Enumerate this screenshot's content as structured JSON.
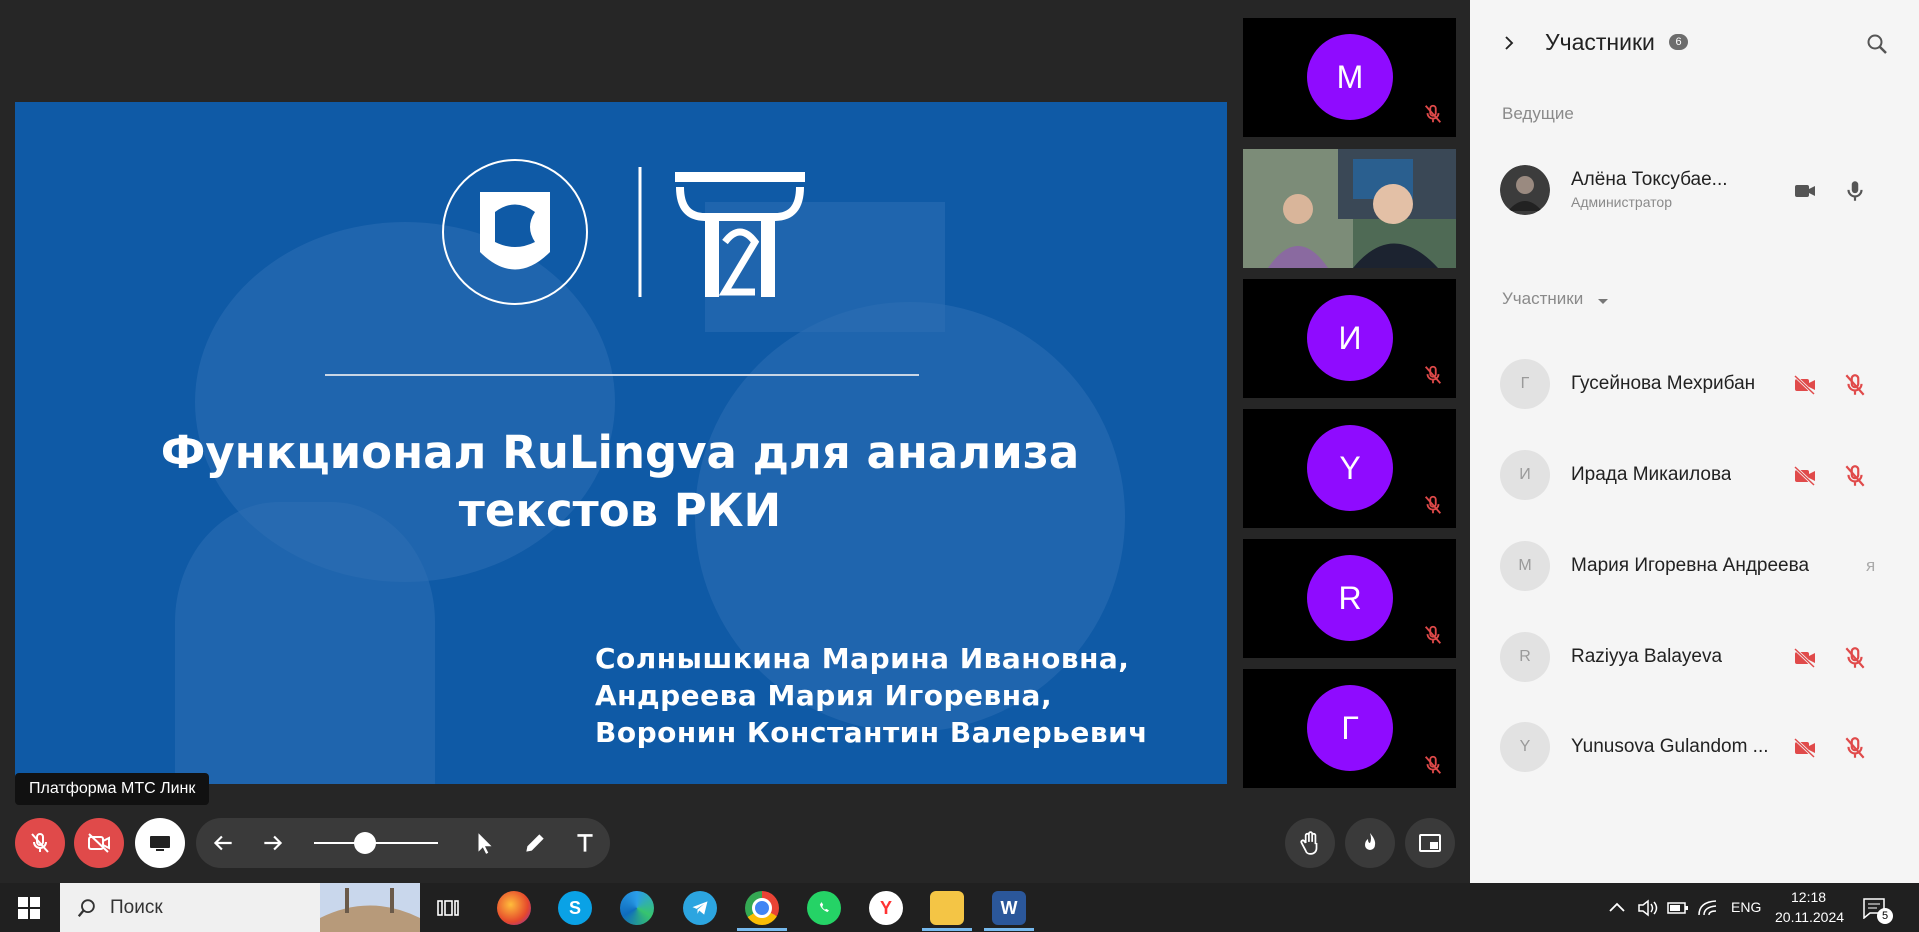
{
  "slide": {
    "title_line1": "Функционал RuLingva для анализа",
    "title_line2": "текстов РКИ",
    "authors": [
      "Солнышкина Марина Ивановна,",
      "Андреева Мария Игоревна,",
      "Воронин Константин Валерьевич"
    ]
  },
  "tiles": [
    {
      "letter": "М"
    },
    {
      "letter": "И"
    },
    {
      "letter": "Y"
    },
    {
      "letter": "R"
    },
    {
      "letter": "Г"
    }
  ],
  "tooltip": "Платформа МТС Линк",
  "panel": {
    "title": "Участники",
    "count": "6",
    "hosts_label": "Ведущие",
    "host": {
      "name": "Алёна Токсубае...",
      "role": "Администратор"
    },
    "participants_label": "Участники",
    "participants": [
      {
        "letter": "Г",
        "name": "Гусейнова Мехрибан"
      },
      {
        "letter": "И",
        "name": "Ирада Микаилова"
      },
      {
        "letter": "М",
        "name": "Мария Игоревна Андреева",
        "suffix": "я"
      },
      {
        "letter": "R",
        "name": "Raziyya Balayeva"
      },
      {
        "letter": "Y",
        "name": "Yunusova Gulandom ..."
      }
    ]
  },
  "taskbar": {
    "search_placeholder": "Поиск",
    "lang": "ENG",
    "time": "12:18",
    "date": "20.11.2024",
    "notif_count": "5"
  },
  "colors": {
    "accent_purple": "#8f0bff",
    "muted_red": "#e04a4a",
    "slide_blue": "#0f5aa6"
  }
}
